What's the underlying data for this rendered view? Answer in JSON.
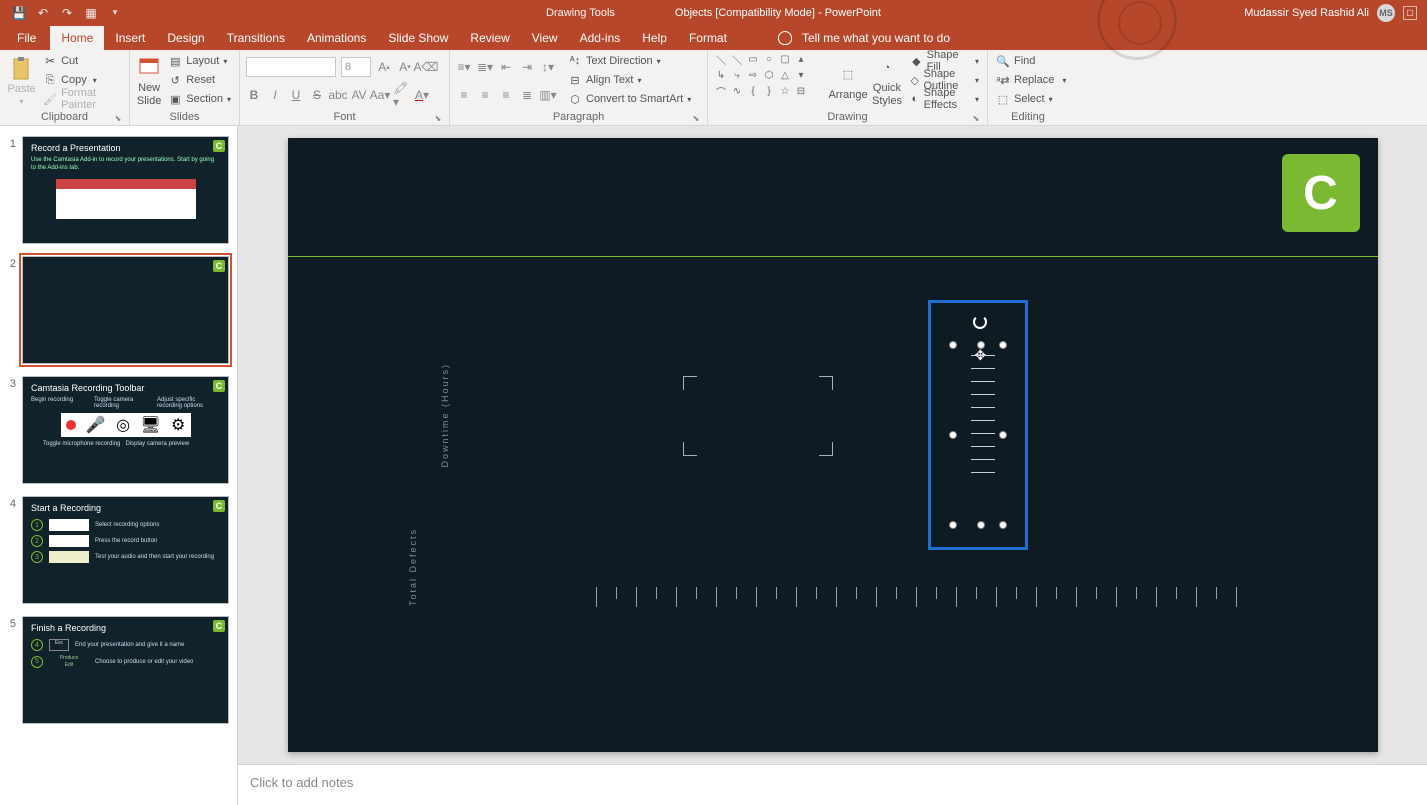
{
  "titleBar": {
    "drawingTools": "Drawing Tools",
    "docTitle": "Objects [Compatibility Mode]  -  PowerPoint",
    "userName": "Mudassir Syed Rashid Ali",
    "userInitials": "MS"
  },
  "tabs": {
    "file": "File",
    "home": "Home",
    "insert": "Insert",
    "design": "Design",
    "transitions": "Transitions",
    "animations": "Animations",
    "slideShow": "Slide Show",
    "review": "Review",
    "view": "View",
    "addins": "Add-ins",
    "help": "Help",
    "format": "Format",
    "tellMe": "Tell me what you want to do"
  },
  "ribbon": {
    "clipboard": {
      "label": "Clipboard",
      "paste": "Paste",
      "cut": "Cut",
      "copy": "Copy",
      "formatPainter": "Format Painter"
    },
    "slides": {
      "label": "Slides",
      "newSlide": "New Slide",
      "layout": "Layout",
      "reset": "Reset",
      "section": "Section"
    },
    "font": {
      "label": "Font",
      "size": "8"
    },
    "paragraph": {
      "label": "Paragraph",
      "textDirection": "Text Direction",
      "alignText": "Align Text",
      "smartArt": "Convert to SmartArt"
    },
    "drawing": {
      "label": "Drawing",
      "arrange": "Arrange",
      "quickStyles": "Quick Styles",
      "shapeFill": "Shape Fill",
      "shapeOutline": "Shape Outline",
      "shapeEffects": "Shape Effects"
    },
    "editing": {
      "label": "Editing",
      "find": "Find",
      "replace": "Replace",
      "select": "Select"
    }
  },
  "thumbs": {
    "t1": {
      "num": "1",
      "title": "Record a Presentation",
      "text": "Use the Camtasia Add-in to record your presentations. Start by going to the Add-ins tab."
    },
    "t2": {
      "num": "2"
    },
    "t3": {
      "num": "3",
      "title": "Camtasia Recording Toolbar",
      "c1": "Begin recording",
      "c2": "Toggle camera recording",
      "c3": "Adjust specific recording options",
      "c4": "Toggle microphone recording",
      "c5": "Display camera preview"
    },
    "t4": {
      "num": "4",
      "title": "Start a Recording",
      "s1": "Select recording options",
      "s2": "Press the record button",
      "s3": "Test your audio and then start your recording"
    },
    "t5": {
      "num": "5",
      "title": "Finish a Recording",
      "s4": "End your presentation and give it a name",
      "s5": "Choose to produce or edit your video",
      "esc": "Esc",
      "produce": "Produce",
      "edit": "Edit"
    }
  },
  "slide": {
    "yLabel1": "Downtime (Hours)",
    "yLabel2": "Total Defects"
  },
  "notes": {
    "placeholder": "Click to add notes"
  }
}
